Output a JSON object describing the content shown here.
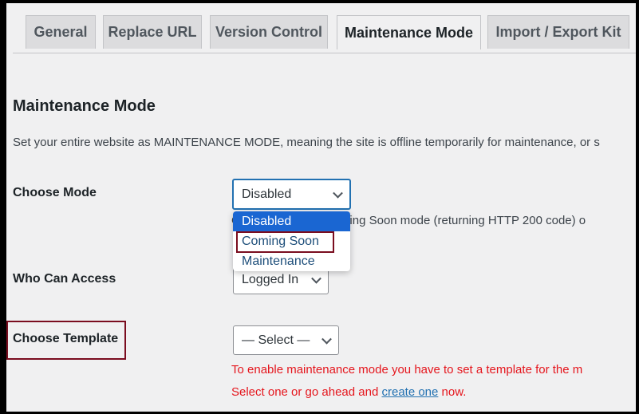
{
  "tabs": [
    {
      "label": "General",
      "active": false
    },
    {
      "label": "Replace URL",
      "active": false
    },
    {
      "label": "Version Control",
      "active": false
    },
    {
      "label": "Maintenance Mode",
      "active": true
    },
    {
      "label": "Import / Export Kit",
      "active": false
    }
  ],
  "page": {
    "title": "Maintenance Mode",
    "description": "Set your entire website as MAINTENANCE MODE, meaning the site is offline temporarily for maintenance, or s"
  },
  "fields": {
    "choose_mode": {
      "label": "Choose Mode",
      "value": "Disabled",
      "description": "Choose between Coming Soon mode (returning HTTP 200 code) o",
      "options": [
        "Disabled",
        "Coming Soon",
        "Maintenance"
      ],
      "highlighted_option": "Coming Soon"
    },
    "who_can_access": {
      "label": "Who Can Access",
      "value": "Logged In"
    },
    "choose_template": {
      "label": "Choose Template",
      "value": "— Select —",
      "notice_line1": "To enable maintenance mode you have to set a template for the m",
      "notice_line2_before": "Select one or go ahead and ",
      "notice_link": "create one",
      "notice_line2_after": " now."
    }
  },
  "colors": {
    "background": "#f0f0f1",
    "accent": "#2271b1",
    "selected_option": "#1a66d2",
    "highlight_box": "#7a0d1f",
    "error_text": "#e5161d"
  }
}
